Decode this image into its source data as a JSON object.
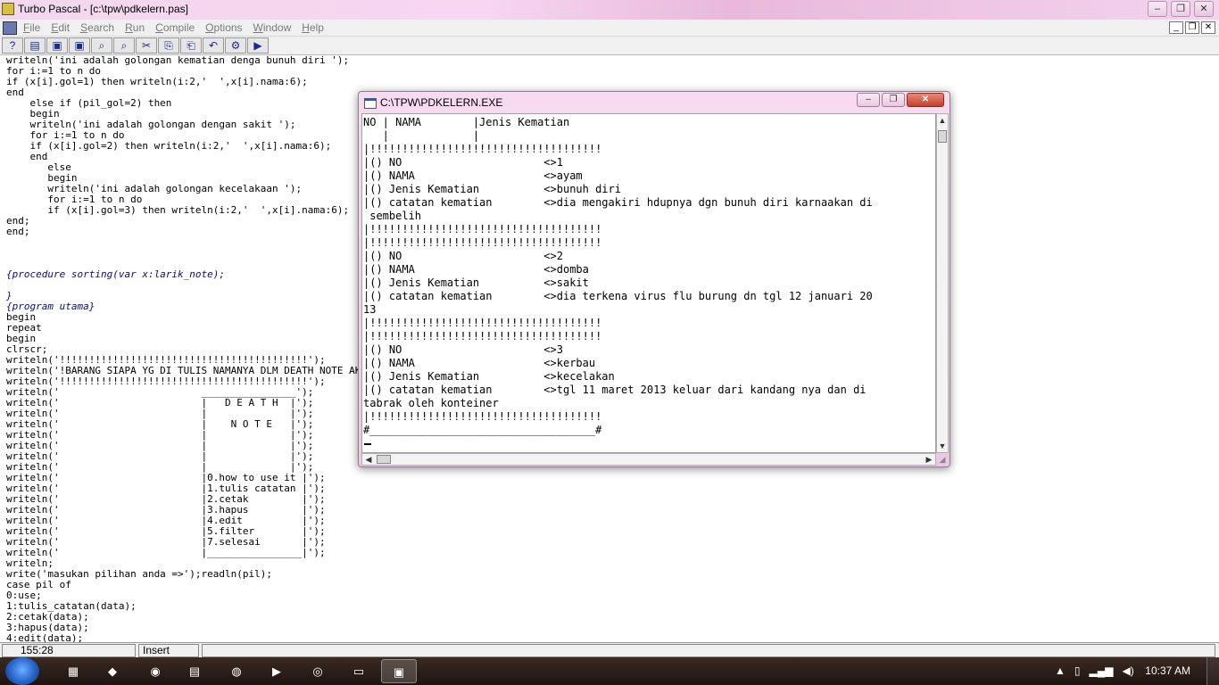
{
  "app": {
    "title": "Turbo Pascal - [c:\\tpw\\pdkelern.pas]",
    "window_buttons": [
      "–",
      "❐",
      "✕"
    ]
  },
  "menu": {
    "items": [
      "File",
      "Edit",
      "Search",
      "Run",
      "Compile",
      "Options",
      "Window",
      "Help"
    ],
    "mdi_buttons": [
      "_",
      "❐",
      "✕"
    ]
  },
  "toolbar": {
    "tools": [
      {
        "icon": "help-icon",
        "glyph": "?"
      },
      {
        "icon": "open-file-icon",
        "glyph": "▤"
      },
      {
        "icon": "save-icon",
        "glyph": "▣"
      },
      {
        "icon": "save-all-icon",
        "glyph": "▣"
      },
      {
        "icon": "find-icon",
        "glyph": "⌕"
      },
      {
        "icon": "replace-icon",
        "glyph": "⌕"
      },
      {
        "icon": "cut-icon",
        "glyph": "✂"
      },
      {
        "icon": "copy-icon",
        "glyph": "⎘"
      },
      {
        "icon": "paste-icon",
        "glyph": "⎗"
      },
      {
        "icon": "undo-icon",
        "glyph": "↶"
      },
      {
        "icon": "compile-icon",
        "glyph": "⚙"
      },
      {
        "icon": "run-icon",
        "glyph": "▶"
      }
    ]
  },
  "editor": {
    "lines": [
      {
        "text": "writeln('ini adalah golongan kematian denga bunuh diri ');",
        "type": "code"
      },
      {
        "text": "for i:=1 to n do",
        "type": "code"
      },
      {
        "text": "if (x[i].gol=1) then writeln(i:2,'  ',x[i].nama:6);",
        "type": "code"
      },
      {
        "text": "end",
        "type": "code"
      },
      {
        "text": "    else if (pil_gol=2) then",
        "type": "code"
      },
      {
        "text": "    begin",
        "type": "code"
      },
      {
        "text": "    writeln('ini adalah golongan dengan sakit ');",
        "type": "code"
      },
      {
        "text": "    for i:=1 to n do",
        "type": "code"
      },
      {
        "text": "    if (x[i].gol=2) then writeln(i:2,'  ',x[i].nama:6);",
        "type": "code"
      },
      {
        "text": "    end",
        "type": "code"
      },
      {
        "text": "       else",
        "type": "code"
      },
      {
        "text": "       begin",
        "type": "code"
      },
      {
        "text": "       writeln('ini adalah golongan kecelakaan ');",
        "type": "code"
      },
      {
        "text": "       for i:=1 to n do",
        "type": "code"
      },
      {
        "text": "       if (x[i].gol=3) then writeln(i:2,'  ',x[i].nama:6);",
        "type": "code"
      },
      {
        "text": "end;",
        "type": "code"
      },
      {
        "text": "end;",
        "type": "code"
      },
      {
        "text": "",
        "type": "code"
      },
      {
        "text": "",
        "type": "code"
      },
      {
        "text": "",
        "type": "code"
      },
      {
        "text": "{procedure sorting(var x:larik_note);",
        "type": "comment"
      },
      {
        "text": "",
        "type": "code"
      },
      {
        "text": "}",
        "type": "comment"
      },
      {
        "text": "{program utama}",
        "type": "comment"
      },
      {
        "text": "begin",
        "type": "code"
      },
      {
        "text": "repeat",
        "type": "code"
      },
      {
        "text": "begin",
        "type": "code"
      },
      {
        "text": "clrscr;",
        "type": "code"
      },
      {
        "text": "writeln('!!!!!!!!!!!!!!!!!!!!!!!!!!!!!!!!!!!!!!!!!!');",
        "type": "code"
      },
      {
        "text": "writeln('!BARANG SIAPA YG DI TULIS NAMANYA DLM DEATH NOTE AKAN MATI!');",
        "type": "code"
      },
      {
        "text": "writeln('!!!!!!!!!!!!!!!!!!!!!!!!!!!!!!!!!!!!!!!!!!');",
        "type": "code"
      },
      {
        "text": "writeln('                        ________________');",
        "type": "code"
      },
      {
        "text": "writeln('                        |   D E A T H  |');",
        "type": "code"
      },
      {
        "text": "writeln('                        |              |');",
        "type": "code"
      },
      {
        "text": "writeln('                        |    N O T E   |');",
        "type": "code"
      },
      {
        "text": "writeln('                        |              |');",
        "type": "code"
      },
      {
        "text": "writeln('                        |              |');",
        "type": "code"
      },
      {
        "text": "writeln('                        |              |');",
        "type": "code"
      },
      {
        "text": "writeln('                        |              |');",
        "type": "code"
      },
      {
        "text": "writeln('                        |0.how to use it |');",
        "type": "code"
      },
      {
        "text": "writeln('                        |1.tulis catatan |');",
        "type": "code"
      },
      {
        "text": "writeln('                        |2.cetak         |');",
        "type": "code"
      },
      {
        "text": "writeln('                        |3.hapus         |');",
        "type": "code"
      },
      {
        "text": "writeln('                        |4.edit          |');",
        "type": "code"
      },
      {
        "text": "writeln('                        |5.filter        |');",
        "type": "code"
      },
      {
        "text": "writeln('                        |7.selesai       |');",
        "type": "code"
      },
      {
        "text": "writeln('                        |________________|');",
        "type": "code"
      },
      {
        "text": "writeln;",
        "type": "code"
      },
      {
        "text": "write('masukan pilihan anda =>');readln(pil);",
        "type": "code"
      },
      {
        "text": "case pil of",
        "type": "code"
      },
      {
        "text": "0:use;",
        "type": "code"
      },
      {
        "text": "1:tulis_catatan(data);",
        "type": "code"
      },
      {
        "text": "2:cetak(data);",
        "type": "code"
      },
      {
        "text": "3:hapus(data);",
        "type": "code"
      },
      {
        "text": "4:edit(data);",
        "type": "code"
      }
    ]
  },
  "console": {
    "title": "C:\\TPW\\PDKELERN.EXE",
    "buttons": [
      "–",
      "❐",
      "✕"
    ],
    "lines": [
      "NO | NAMA        |Jenis Kematian",
      "   |             |",
      "|!!!!!!!!!!!!!!!!!!!!!!!!!!!!!!!!!!!!",
      "|() NO                      <>1",
      "|() NAMA                    <>ayam",
      "|() Jenis Kematian          <>bunuh diri",
      "|() catatan kematian        <>dia mengakiri hdupnya dgn bunuh diri karnaakan di",
      " sembelih",
      "|!!!!!!!!!!!!!!!!!!!!!!!!!!!!!!!!!!!!",
      "|!!!!!!!!!!!!!!!!!!!!!!!!!!!!!!!!!!!!",
      "|() NO                      <>2",
      "|() NAMA                    <>domba",
      "|() Jenis Kematian          <>sakit",
      "|() catatan kematian        <>dia terkena virus flu burung dn tgl 12 januari 20",
      "13",
      "|!!!!!!!!!!!!!!!!!!!!!!!!!!!!!!!!!!!!",
      "|!!!!!!!!!!!!!!!!!!!!!!!!!!!!!!!!!!!!",
      "|() NO                      <>3",
      "|() NAMA                    <>kerbau",
      "|() Jenis Kematian          <>kecelakan",
      "|() catatan kematian        <>tgl 11 maret 2013 keluar dari kandang nya dan di",
      "tabrak oleh konteiner",
      "|!!!!!!!!!!!!!!!!!!!!!!!!!!!!!!!!!!!!",
      "#___________________________________#"
    ]
  },
  "status": {
    "position": "155:28",
    "mode": "Insert"
  },
  "taskbar": {
    "apps": [
      {
        "icon": "file-explorer-icon",
        "glyph": "▦",
        "active": false
      },
      {
        "icon": "books-icon",
        "glyph": "◆",
        "active": false
      },
      {
        "icon": "media-disc-icon",
        "glyph": "◉",
        "active": false
      },
      {
        "icon": "calculator-icon",
        "glyph": "▤",
        "active": false
      },
      {
        "icon": "firefox-icon",
        "glyph": "◍",
        "active": false
      },
      {
        "icon": "media-player-icon",
        "glyph": "▶",
        "active": false
      },
      {
        "icon": "chrome-icon",
        "glyph": "◎",
        "active": false
      },
      {
        "icon": "console-window-icon",
        "glyph": "▭",
        "active": false
      },
      {
        "icon": "turbo-pascal-icon",
        "glyph": "▣",
        "active": true
      }
    ],
    "clock": "10:37 AM"
  }
}
